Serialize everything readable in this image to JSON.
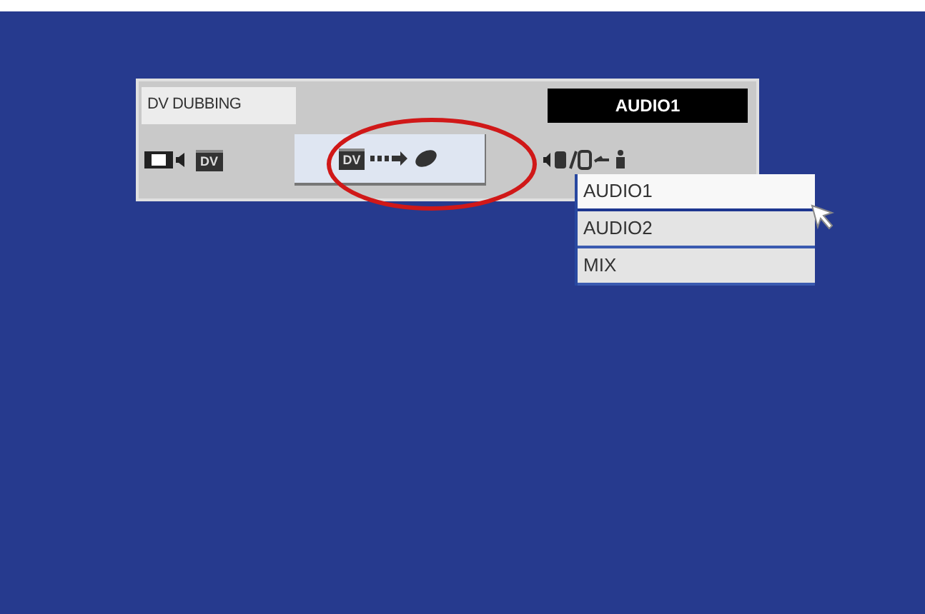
{
  "panel": {
    "title": "DV DUBBING",
    "current_value": "AUDIO1",
    "input_icon_label": "DV",
    "dub_button": {
      "label": "DV",
      "highlighted": true
    }
  },
  "dropdown": {
    "items": [
      {
        "label": "AUDIO1",
        "selected": true
      },
      {
        "label": "AUDIO2",
        "selected": false
      },
      {
        "label": "MIX",
        "selected": false
      }
    ]
  }
}
